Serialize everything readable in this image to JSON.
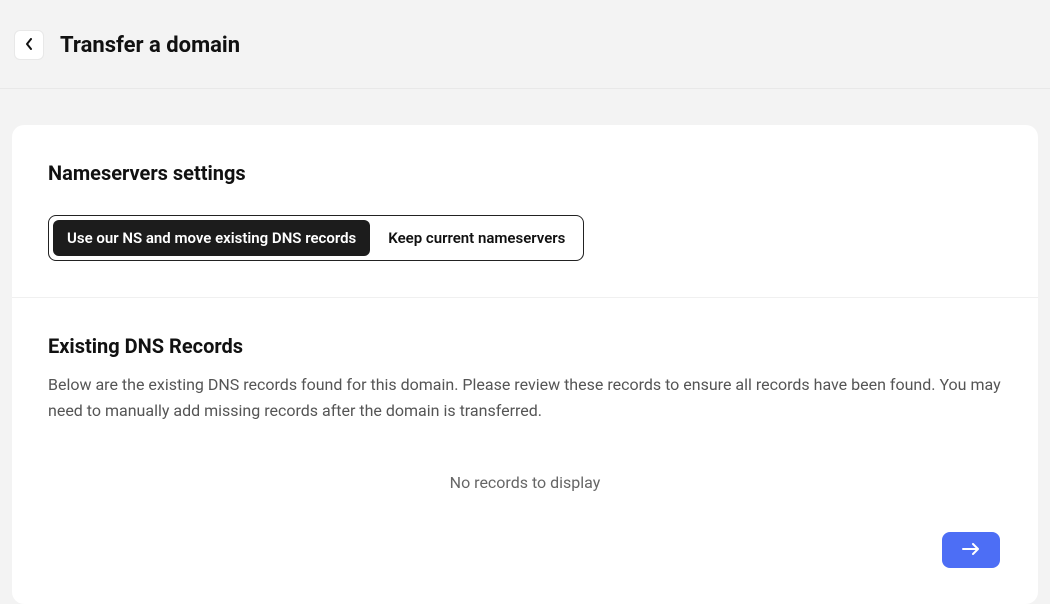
{
  "header": {
    "title": "Transfer a domain"
  },
  "nameservers": {
    "section_title": "Nameservers settings",
    "options": [
      {
        "label": "Use our NS and move existing DNS records",
        "active": true
      },
      {
        "label": "Keep current nameservers",
        "active": false
      }
    ]
  },
  "dns_records": {
    "section_title": "Existing DNS Records",
    "description": "Below are the existing DNS records found for this domain. Please review these records to ensure all records have been found. You may need to manually add missing records after the domain is transferred.",
    "empty_message": "No records to display"
  }
}
